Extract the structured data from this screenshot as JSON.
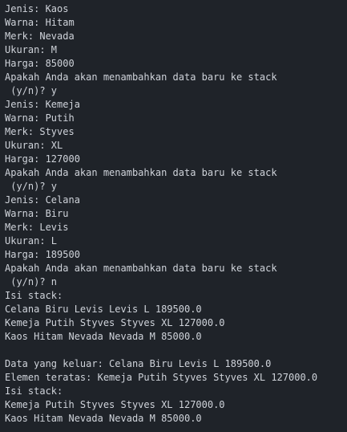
{
  "console": {
    "lines": [
      "Jenis: Kaos",
      "Warna: Hitam",
      "Merk: Nevada",
      "Ukuran: M",
      "Harga: 85000",
      "Apakah Anda akan menambahkan data baru ke stack",
      " (y/n)? y",
      "Jenis: Kemeja",
      "Warna: Putih",
      "Merk: Styves",
      "Ukuran: XL",
      "Harga: 127000",
      "Apakah Anda akan menambahkan data baru ke stack",
      " (y/n)? y",
      "Jenis: Celana",
      "Warna: Biru",
      "Merk: Levis",
      "Ukuran: L",
      "Harga: 189500",
      "Apakah Anda akan menambahkan data baru ke stack",
      " (y/n)? n",
      "Isi stack:",
      "Celana Biru Levis Levis L 189500.0",
      "Kemeja Putih Styves Styves XL 127000.0",
      "Kaos Hitam Nevada Nevada M 85000.0",
      "",
      "Data yang keluar: Celana Biru Levis L 189500.0",
      "Elemen teratas: Kemeja Putih Styves Styves XL 127000.0",
      "Isi stack:",
      "Kemeja Putih Styves Styves XL 127000.0",
      "Kaos Hitam Nevada Nevada M 85000.0"
    ]
  }
}
